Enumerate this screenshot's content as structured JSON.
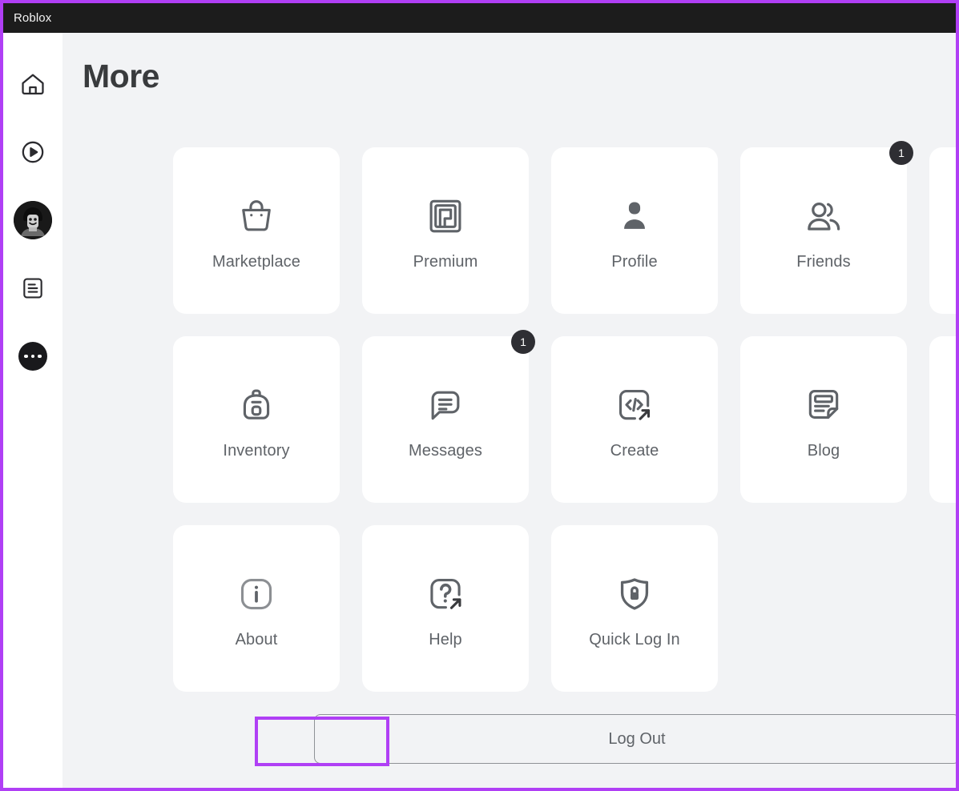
{
  "window": {
    "title": "Roblox"
  },
  "sidebar": {
    "items": [
      {
        "name": "home",
        "icon": "home-icon",
        "label": "Home"
      },
      {
        "name": "discover",
        "icon": "play-circle-icon",
        "label": "Discover"
      },
      {
        "name": "avatar",
        "icon": "avatar-icon",
        "label": "Avatar"
      },
      {
        "name": "news",
        "icon": "document-icon",
        "label": "News"
      },
      {
        "name": "more",
        "icon": "more-dots-icon",
        "label": "More"
      }
    ]
  },
  "page": {
    "title": "More"
  },
  "tiles": [
    {
      "label": "Marketplace",
      "icon": "shopping-bag-icon",
      "badge": ""
    },
    {
      "label": "Premium",
      "icon": "premium-icon",
      "badge": ""
    },
    {
      "label": "Profile",
      "icon": "person-icon",
      "badge": ""
    },
    {
      "label": "Friends",
      "icon": "people-icon",
      "badge": "1"
    },
    {
      "label": "",
      "icon": "",
      "badge": ""
    },
    {
      "label": "Inventory",
      "icon": "backpack-icon",
      "badge": ""
    },
    {
      "label": "Messages",
      "icon": "message-icon",
      "badge": "1"
    },
    {
      "label": "Create",
      "icon": "code-external-link-icon",
      "badge": ""
    },
    {
      "label": "Blog",
      "icon": "blog-icon",
      "badge": ""
    },
    {
      "label": "",
      "icon": "",
      "badge": ""
    },
    {
      "label": "About",
      "icon": "info-icon",
      "badge": ""
    },
    {
      "label": "Help",
      "icon": "question-external-link-icon",
      "badge": ""
    },
    {
      "label": "Quick Log In",
      "icon": "shield-lock-icon",
      "badge": ""
    }
  ],
  "footer": {
    "logout_label": "Log Out"
  },
  "colors": {
    "accent_highlight": "#b03ff5",
    "titlebar_background": "#1c1c1c",
    "page_background": "#f2f3f5",
    "tile_background": "#ffffff",
    "icon_gray": "#5f6368",
    "badge_background": "#2e2e33"
  }
}
